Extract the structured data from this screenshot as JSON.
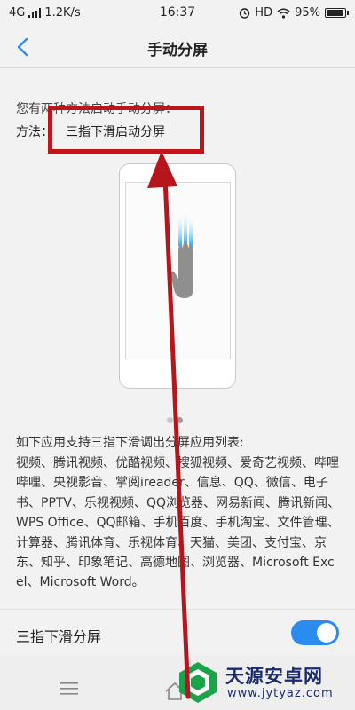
{
  "status_bar": {
    "network": "4G",
    "speed": "1.2K/s",
    "time": "16:37",
    "hd": "HD",
    "battery_text": "95%",
    "battery_level": 0.95
  },
  "header": {
    "title": "手动分屏"
  },
  "content": {
    "intro_text": "您有两种方法启动手动分屏：",
    "method_label": "方法：",
    "method_value": "三指下滑启动分屏",
    "apps_title": "如下应用支持三指下滑调出分屏应用列表:",
    "apps_list": "视频、腾讯视频、优酷视频、搜狐视频、爱奇艺视频、哔哩哔哩、央视影音、掌阅ireader、信息、QQ、微信、电子书、PPTV、乐视视频、QQ浏览器、网易新闻、腾讯新闻、WPS Office、QQ邮箱、手机百度、手机淘宝、文件管理、计算器、腾讯体育、乐视体育、天猫、美团、支付宝、京东、知乎、印象笔记、高德地图、浏览器、Microsoft Excel、Microsoft Word。",
    "carousel": {
      "total": 2,
      "active": 1
    }
  },
  "toggle_row": {
    "label": "三指下滑分屏",
    "enabled": true
  },
  "watermark": {
    "name": "天源安卓网",
    "url": "www.jytyaz.com"
  },
  "colors": {
    "accent": "#2b8cf0",
    "annotation": "#c0141a",
    "background": "#f2f2f2"
  }
}
